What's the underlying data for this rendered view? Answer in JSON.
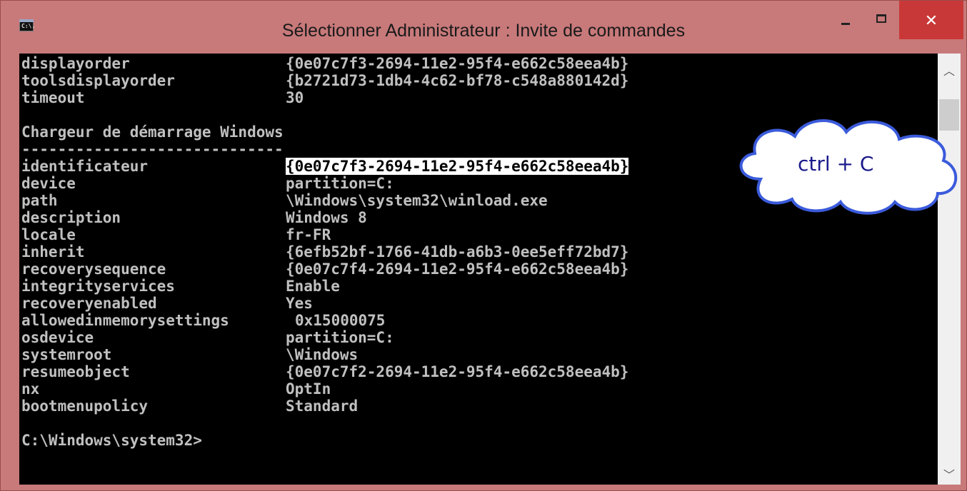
{
  "window": {
    "title": "Sélectionner Administrateur : Invite de commandes",
    "icon_label": "C:\\."
  },
  "console": {
    "lines": [
      {
        "key": "displayorder",
        "value": "{0e07c7f3-2694-11e2-95f4-e662c58eea4b}"
      },
      {
        "key": "toolsdisplayorder",
        "value": "{b2721d73-1db4-4c62-bf78-c548a880142d}"
      },
      {
        "key": "timeout",
        "value": "30"
      },
      {
        "key": "",
        "value": ""
      },
      {
        "key": "Chargeur de démarrage Windows",
        "value": ""
      },
      {
        "key": "-----------------------------",
        "value": ""
      },
      {
        "key": "identificateur",
        "value": "{0e07c7f3-2694-11e2-95f4-e662c58eea4b}",
        "selected": true
      },
      {
        "key": "device",
        "value": "partition=C:"
      },
      {
        "key": "path",
        "value": "\\Windows\\system32\\winload.exe"
      },
      {
        "key": "description",
        "value": "Windows 8"
      },
      {
        "key": "locale",
        "value": "fr-FR"
      },
      {
        "key": "inherit",
        "value": "{6efb52bf-1766-41db-a6b3-0ee5eff72bd7}"
      },
      {
        "key": "recoverysequence",
        "value": "{0e07c7f4-2694-11e2-95f4-e662c58eea4b}"
      },
      {
        "key": "integrityservices",
        "value": "Enable"
      },
      {
        "key": "recoveryenabled",
        "value": "Yes"
      },
      {
        "key": "allowedinmemorysettings",
        "value": "0x15000075",
        "wide": true
      },
      {
        "key": "osdevice",
        "value": "partition=C:"
      },
      {
        "key": "systemroot",
        "value": "\\Windows"
      },
      {
        "key": "resumeobject",
        "value": "{0e07c7f2-2694-11e2-95f4-e662c58eea4b}"
      },
      {
        "key": "nx",
        "value": "OptIn"
      },
      {
        "key": "bootmenupolicy",
        "value": "Standard"
      },
      {
        "key": "",
        "value": ""
      },
      {
        "key": "C:\\Windows\\system32>",
        "value": ""
      }
    ]
  },
  "annotation": {
    "text": "ctrl + C"
  },
  "colors": {
    "frame": "#c8797a",
    "close_button": "#c93838",
    "console_bg": "#000000",
    "console_text": "#c0c0c0",
    "annotation_text": "#1a1a8c"
  }
}
